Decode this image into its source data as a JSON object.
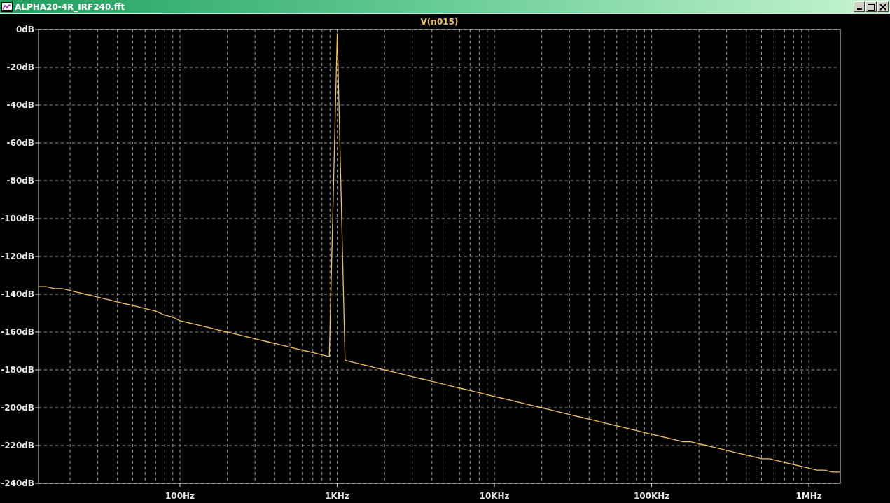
{
  "window": {
    "title": "ALPHA20-4R_IRF240.fft"
  },
  "plot": {
    "chart_data": {
      "type": "line",
      "grid": true,
      "categories": [
        null,
        null,
        null,
        null,
        null,
        null,
        null,
        null,
        null,
        null,
        null,
        null,
        null,
        null,
        null,
        null,
        null,
        null,
        "100Hz",
        null,
        null,
        null,
        null,
        null,
        null,
        null,
        null,
        null,
        null,
        null,
        null,
        null,
        null,
        null,
        null,
        null,
        null,
        null,
        "1KHz",
        null,
        null,
        null,
        null,
        null,
        null,
        null,
        null,
        null,
        null,
        null,
        null,
        null,
        null,
        null,
        null,
        null,
        null,
        null,
        "10KHz",
        null,
        null,
        null,
        null,
        null,
        null,
        null,
        null,
        null,
        null,
        null,
        null,
        null,
        null,
        null,
        null,
        null,
        null,
        null,
        "100KHz",
        null,
        null,
        null,
        null,
        null,
        null,
        null,
        null,
        null,
        null,
        null,
        null,
        null,
        null,
        null,
        null,
        null,
        null,
        null,
        "1MHz",
        null,
        null,
        null,
        null
      ],
      "series": [
        {
          "name": "V(n015)",
          "color": "#f0c060",
          "values": [
            -136,
            -136,
            -137,
            -137,
            -138,
            -139,
            -140,
            -141,
            -142,
            -143,
            -144,
            -145,
            -146,
            -147,
            -148,
            -149,
            -151,
            -152,
            -154,
            -155,
            -156,
            -157,
            -158,
            -159,
            -160,
            -161,
            -162,
            -163,
            -164,
            -165,
            -166,
            -167,
            -168,
            -169,
            -170,
            -171,
            -172,
            -173,
            -2,
            -175,
            -176,
            -177,
            -178,
            -179,
            -180,
            -181,
            -182,
            -183,
            -184,
            -185,
            -186,
            -187,
            -188,
            -189,
            -190,
            -191,
            -192,
            -193,
            -194,
            -195,
            -196,
            -197,
            -198,
            -199,
            -200,
            -201,
            -202,
            -203,
            -204,
            -205,
            -206,
            -207,
            -208,
            -209,
            -210,
            -211,
            -212,
            -213,
            -214,
            -215,
            -216,
            -217,
            -218,
            -218,
            -219,
            -220,
            -221,
            -222,
            -223,
            -224,
            -225,
            -226,
            -227,
            -227,
            -228,
            -229,
            -230,
            -231,
            -232,
            -233,
            -233,
            -234,
            -234
          ]
        }
      ],
      "ylim": [
        -240,
        0
      ],
      "yticks": [
        {
          "value": 0,
          "label": "0dB"
        },
        {
          "value": -20,
          "label": "-20dB"
        },
        {
          "value": -40,
          "label": "-40dB"
        },
        {
          "value": -60,
          "label": "-60dB"
        },
        {
          "value": -80,
          "label": "-80dB"
        },
        {
          "value": -100,
          "label": "-100dB"
        },
        {
          "value": -120,
          "label": "-120dB"
        },
        {
          "value": -140,
          "label": "-140dB"
        },
        {
          "value": -160,
          "label": "-160dB"
        },
        {
          "value": -180,
          "label": "-180dB"
        },
        {
          "value": -200,
          "label": "-200dB"
        },
        {
          "value": -220,
          "label": "-220dB"
        },
        {
          "value": -240,
          "label": "-240dB"
        }
      ]
    }
  }
}
